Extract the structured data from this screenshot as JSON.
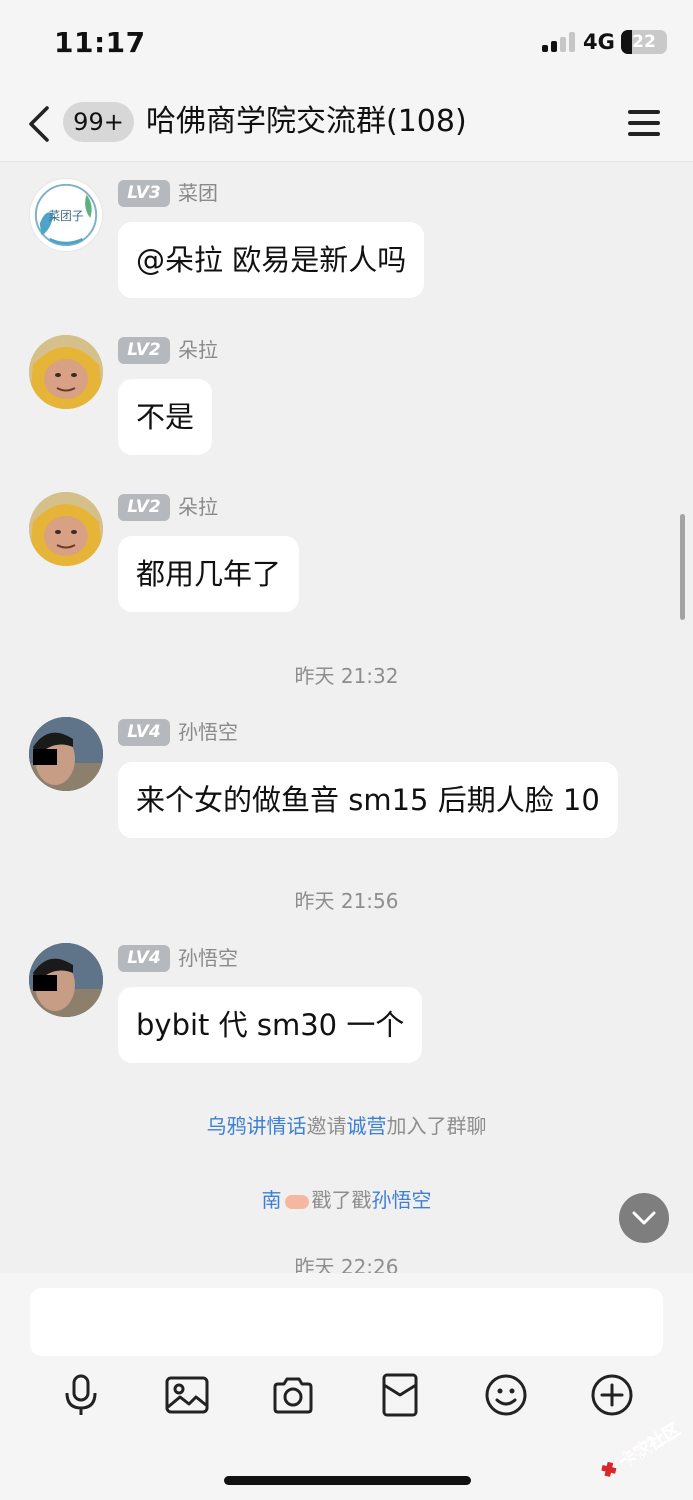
{
  "status_bar": {
    "time": "11:17",
    "network": "4G",
    "battery": "22"
  },
  "nav": {
    "unread_badge": "99+",
    "title": "哈佛商学院交流群(108)"
  },
  "messages": [
    {
      "level": "LV3",
      "name": "菜团",
      "text": "@朵拉 欧易是新人吗"
    },
    {
      "level": "LV2",
      "name": "朵拉",
      "text": "不是"
    },
    {
      "level": "LV2",
      "name": "朵拉",
      "text": "都用几年了"
    },
    {
      "level": "LV4",
      "name": "孙悟空",
      "text": "来个女的做鱼音 sm15 后期人脸 10"
    },
    {
      "level": "LV4",
      "name": "孙悟空",
      "text": "bybit 代 sm30 一个"
    }
  ],
  "timestamps": [
    "昨天 21:32",
    "昨天 21:56",
    "昨天 22:26"
  ],
  "system_invite": {
    "inviter": "乌鸦讲情话",
    "verb": "邀请",
    "invitee": "诚营",
    "suffix": "加入了群聊"
  },
  "system_poke": {
    "actor": "南",
    "verb": "戳了戳",
    "target": "孙悟空"
  },
  "avatar_text": {
    "caituan": "菜团子"
  },
  "watermark": "卡农社区",
  "icons": {
    "back": "chevron-left-icon",
    "menu": "hamburger-menu-icon",
    "scroll_down": "chevron-down-icon",
    "toolbar": [
      "microphone-icon",
      "image-icon",
      "camera-icon",
      "red-packet-icon",
      "emoji-icon",
      "plus-circle-icon"
    ]
  },
  "colors": {
    "link": "#3e7fd6",
    "level_badge": "#b5b8bd",
    "background": "#f0f0f0"
  }
}
